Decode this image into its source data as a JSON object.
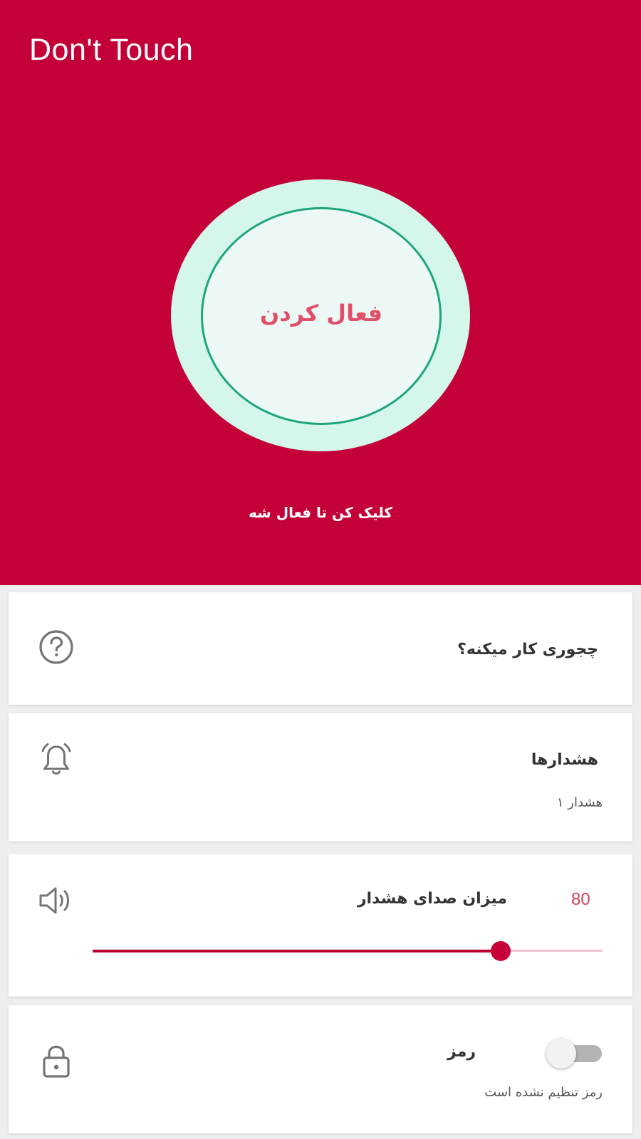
{
  "app": {
    "title": "Don't Touch"
  },
  "hero": {
    "activate_label": "فعال کردن",
    "hint": "کلیک کن تا فعال شه"
  },
  "cards": {
    "how_it_works": {
      "title": "چجوری کار میکنه؟",
      "icon": "help-circle-icon"
    },
    "alarms": {
      "title": "هشدارها",
      "subtitle": "هشدار ۱",
      "icon": "bell-icon"
    },
    "volume": {
      "title": "میزان صدای هشدار",
      "value": "80",
      "level_fraction": 0.8,
      "icon": "speaker-icon"
    },
    "password": {
      "title": "رمز",
      "subtitle": "رمز تنظیم نشده است",
      "enabled": false,
      "icon": "lock-icon"
    }
  },
  "colors": {
    "primary": "#c40038",
    "accent_text": "#e0506a",
    "ring": "#1da57d",
    "ring_fill": "#d5f6ea"
  }
}
